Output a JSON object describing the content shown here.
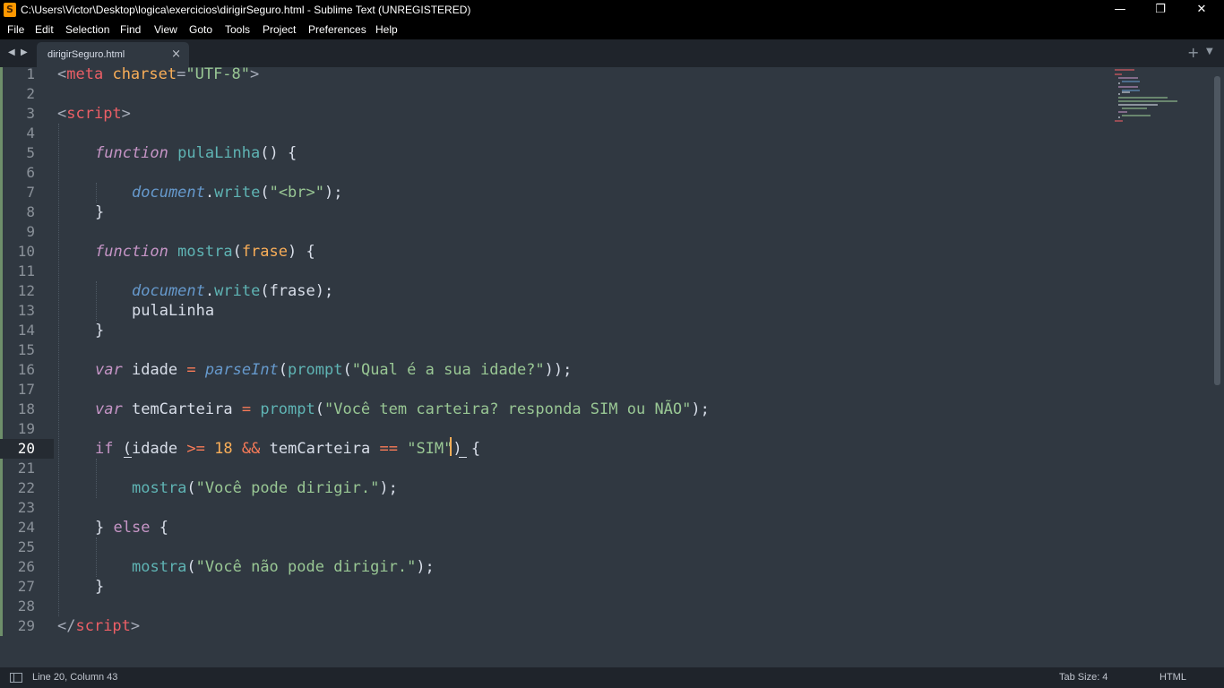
{
  "window": {
    "title": "C:\\Users\\Victor\\Desktop\\logica\\exercicios\\dirigirSeguro.html - Sublime Text (UNREGISTERED)",
    "app_icon_glyph": "S",
    "controls": {
      "minimize": "—",
      "restore": "❐",
      "close": "✕"
    }
  },
  "menu": [
    "File",
    "Edit",
    "Selection",
    "Find",
    "View",
    "Goto",
    "Tools",
    "Project",
    "Preferences",
    "Help"
  ],
  "tabs": {
    "back_arrow": "◀",
    "forward_arrow": "▶",
    "active_tab": "dirigirSeguro.html",
    "close_glyph": "×",
    "new_tab_glyph": "+",
    "menu_glyph": "▼"
  },
  "editor": {
    "line_numbers": [
      "1",
      "2",
      "3",
      "4",
      "5",
      "6",
      "7",
      "8",
      "9",
      "10",
      "11",
      "12",
      "13",
      "14",
      "15",
      "16",
      "17",
      "18",
      "19",
      "20",
      "21",
      "22",
      "23",
      "24",
      "25",
      "26",
      "27",
      "28",
      "29"
    ],
    "current_line": 20,
    "theme_colors": {
      "background": "#303841",
      "tag": "#ec5f66",
      "string": "#99c794",
      "keyword": "#c695c6",
      "function": "#5fb4b4",
      "object": "#6699cc",
      "number": "#f9ae58",
      "operator": "#f97b58",
      "caret": "#f9ae58"
    },
    "code": {
      "l1": {
        "lt": "<",
        "tag": "meta",
        "attr": "charset",
        "eq": "=",
        "val": "\"UTF-8\"",
        "gt": ">"
      },
      "l3": {
        "lt": "<",
        "tag": "script",
        "gt": ">"
      },
      "l5": {
        "kw": "function",
        "name": "pulaLinha",
        "rest": "() {"
      },
      "l7": {
        "obj": "document",
        "dot": ".",
        "method": "write",
        "open": "(",
        "str": "\"<br>\"",
        "close": ");"
      },
      "l8": {
        "text": "}"
      },
      "l10": {
        "kw": "function",
        "name": "mostra",
        "open": "(",
        "param": "frase",
        "rest": ") {"
      },
      "l12": {
        "obj": "document",
        "dot": ".",
        "method": "write",
        "rest": "(frase);"
      },
      "l13": {
        "text": "pulaLinha"
      },
      "l14": {
        "text": "}"
      },
      "l16": {
        "kw": "var",
        "name": "idade",
        "op": "=",
        "fn1": "parseInt",
        "open1": "(",
        "fn2": "prompt",
        "open2": "(",
        "str": "\"Qual é a sua idade?\"",
        "close": "));"
      },
      "l18": {
        "kw": "var",
        "name": "temCarteira",
        "op": "=",
        "fn": "prompt",
        "open": "(",
        "str": "\"Você tem carteira? responda SIM ou NÃO\"",
        "close": ");"
      },
      "l20": {
        "kw": "if",
        "open": "(",
        "var1": "idade",
        "op1": ">=",
        "num": "18",
        "op2": "&&",
        "var2": "temCarteira",
        "op3": "==",
        "str1": "\"SIM",
        "str2": "\"",
        "close": ")",
        "brace": "{"
      },
      "l22": {
        "fn": "mostra",
        "open": "(",
        "str": "\"Você pode dirigir.\"",
        "close": ");"
      },
      "l24": {
        "open": "}",
        "kw": "else",
        "brace": "{"
      },
      "l26": {
        "fn": "mostra",
        "open": "(",
        "str": "\"Você não pode dirigir.\"",
        "close": ");"
      },
      "l27": {
        "text": "}"
      },
      "l29": {
        "lt": "</",
        "tag": "script",
        "gt": ">"
      }
    }
  },
  "status": {
    "position": "Line 20, Column 43",
    "tab_size": "Tab Size: 4",
    "syntax": "HTML"
  }
}
